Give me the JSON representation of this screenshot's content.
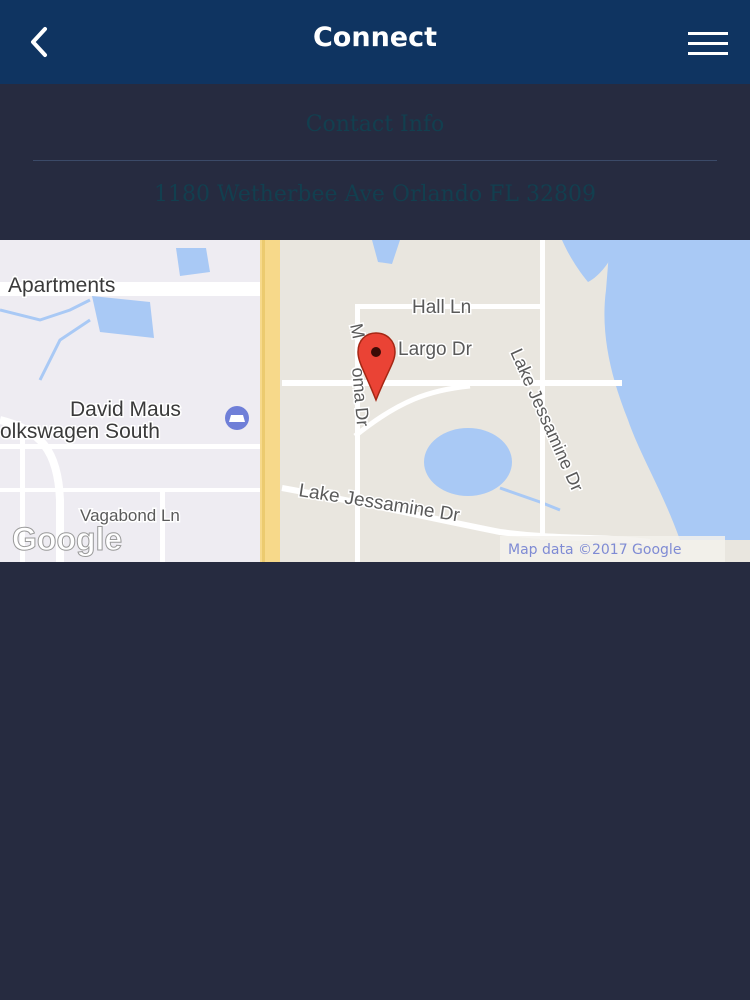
{
  "header": {
    "title": "Connect",
    "back_icon": "chevron-left-icon",
    "menu_icon": "hamburger-menu-icon"
  },
  "info": {
    "contact_label": "Contact Info",
    "address": "1180 Wetherbee Ave Orlando FL 32809"
  },
  "map": {
    "labels": {
      "apartments": "Apartments",
      "hall_ln": "Hall Ln",
      "monte_largo": "Largo Dr",
      "mimosa_part1": "M",
      "mimosa_part2": "oma Dr",
      "lake_jessamine_dr_vertical": "Lake Jessamine Dr",
      "david_maus": "David Maus",
      "volkswagen_south": "olkswagen South",
      "lake_jessamine_dr": "Lake Jessamine Dr",
      "vagabond_ln": "Vagabond Ln",
      "google_logo": "Google",
      "map_data": "Map data ©2017 Google"
    },
    "marker_icon": "map-pin-icon",
    "dealer_icon": "car-dealer-icon",
    "colors": {
      "water": "#a9c9f5",
      "land": "#e9e6df",
      "major_road": "#f7d98a",
      "road": "#ffffff",
      "marker": "#ea4335"
    }
  }
}
